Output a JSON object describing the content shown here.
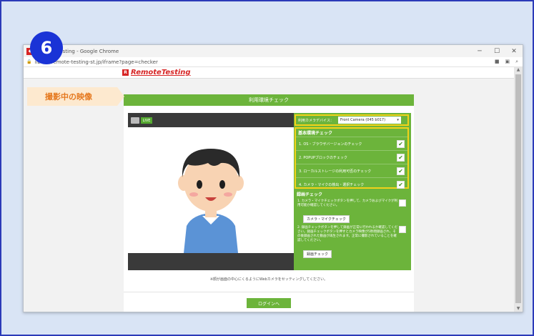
{
  "step_number": "6",
  "window": {
    "title": "Remote Testing - Google Chrome",
    "address": "iibc01.remote-testing-st.jp/iframe?page=checker",
    "controls": {
      "minimize": "─",
      "maximize": "☐",
      "close": "✕"
    }
  },
  "site": {
    "logo_text": "RemoteTesting"
  },
  "panel": {
    "header": "利用環境チェック",
    "live_badge": "LIVE",
    "device": {
      "label": "利用カメラデバイス：",
      "value": "Front Camera (045 b017)"
    },
    "basic_title": "基本環境チェック",
    "basic_checks": [
      {
        "label": "1. OS・ブラウザバージョンのチェック",
        "checked": true
      },
      {
        "label": "2. POPUPブロックのチェック",
        "checked": true
      },
      {
        "label": "3. ローカルストレージの利用可否のチェック",
        "checked": true
      },
      {
        "label": "4. カメラ・マイクの検出・選択チェック",
        "checked": true
      }
    ],
    "record_title": "録画チェック",
    "record_items": [
      {
        "text": "1. カメラ・マイクチェックボタンを押して、カメラおよびマイクが利用可能か確認してください。",
        "button": "カメラ・マイクチェック"
      },
      {
        "text": "2. 録画チェックボタンを押して録画が正常に行われるか確認してください。録画チェックボタンを押すとカメラ映像が5秒間録画され、その後録画された動画が再生されます。正常に撮影されていることを確認してください。",
        "button": "録画チェック"
      }
    ],
    "note": "※顔が画面の中心にくるようにWebカメラをセッティングしてください。",
    "login": "ログインへ"
  },
  "callout": "撮影中の映像",
  "colors": {
    "accent_green": "#6cb43b",
    "highlight_yellow": "#f2d21a",
    "badge_blue": "#1a33d6",
    "callout_orange": "#e5781e"
  }
}
